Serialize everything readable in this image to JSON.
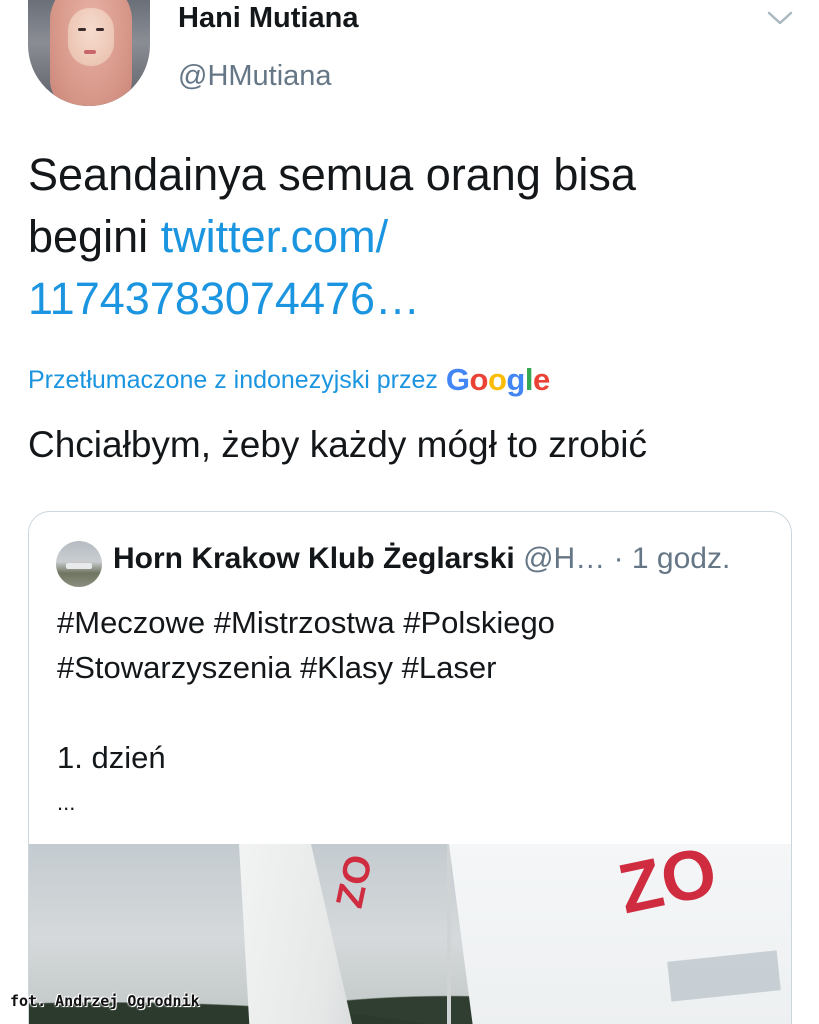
{
  "tweet": {
    "author": {
      "display_name": "Hani Mutiana",
      "handle": "@HMutiana"
    },
    "text_plain": "Seandainya semua orang bisa begini ",
    "text_link": "twitter.com/ 11743783074476…",
    "translation_label": "Przetłumaczone z indonezyjski przez",
    "translation_provider": "Google",
    "translated_text": "Chciałbym, żeby każdy mógł to zrobić"
  },
  "quoted_tweet": {
    "author_name": "Horn Krakow Klub Żeglarski",
    "author_handle": "@H…",
    "time": "· 1 godz.",
    "body_lines": [
      "#Meczowe #Mistrzostwa #Polskiego",
      "#Stowarzyszenia #Klasy #Laser",
      "",
      "1. dzień",
      "..."
    ],
    "image_sail_number": "ZO"
  },
  "photo_credit": "fot. Andrzej Ogrodnik",
  "icons": {
    "menu": "chevron-down-icon"
  },
  "colors": {
    "link": "#1b95e0",
    "secondary_text": "#657786",
    "card_border": "#ccd6dd"
  }
}
